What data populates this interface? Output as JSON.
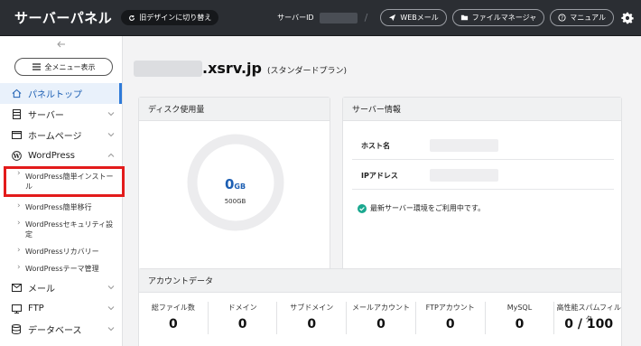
{
  "header": {
    "brand": "サーバーパネル",
    "old_design_label": "旧デザインに切り替え",
    "server_id_label": "サーバーID",
    "webmail_label": "WEBメール",
    "filemanager_label": "ファイルマネージャ",
    "manual_label": "マニュアル",
    "settings_icon": "gear-icon"
  },
  "sidebar": {
    "all_menu_label": "全メニュー表示",
    "items": [
      {
        "label": "パネルトップ",
        "icon": "home-icon"
      },
      {
        "label": "サーバー",
        "icon": "server-icon"
      },
      {
        "label": "ホームページ",
        "icon": "window-icon"
      },
      {
        "label": "WordPress",
        "icon": "wordpress-icon"
      }
    ],
    "wordpress_sub": [
      "WordPress簡単インストール",
      "WordPress簡単移行",
      "WordPressセキュリティ設定",
      "WordPressリカバリー",
      "WordPressテーマ管理"
    ],
    "bottom_items": [
      {
        "label": "メール",
        "icon": "mail-icon"
      },
      {
        "label": "FTP",
        "icon": "monitor-icon"
      },
      {
        "label": "データベース",
        "icon": "database-icon"
      }
    ]
  },
  "main": {
    "domain_suffix": ".xsrv.jp",
    "plan": "(スタンダードプラン)"
  },
  "disk": {
    "title": "ディスク使用量",
    "used_value": "0",
    "used_unit": "GB",
    "total": "500GB",
    "used_fraction": 0
  },
  "server_info": {
    "title": "サーバー情報",
    "host_label": "ホスト名",
    "ip_label": "IPアドレス",
    "status_text": "最新サーバー環境をご利用中です。"
  },
  "account": {
    "title": "アカウントデータ",
    "columns": [
      {
        "label": "総ファイル数",
        "value": "0"
      },
      {
        "label": "ドメイン",
        "value": "0"
      },
      {
        "label": "サブドメイン",
        "value": "0"
      },
      {
        "label": "メールアカウント",
        "value": "0"
      },
      {
        "label": "FTPアカウント",
        "value": "0"
      },
      {
        "label": "MySQL",
        "value": "0"
      },
      {
        "label": "高性能スパムフィルタ",
        "value": "0 / 100"
      }
    ]
  },
  "colors": {
    "header_bg": "#2b2e33",
    "accent": "#1d5fb3",
    "highlight_box": "#e31b1b",
    "status_ok": "#1aa88f"
  }
}
